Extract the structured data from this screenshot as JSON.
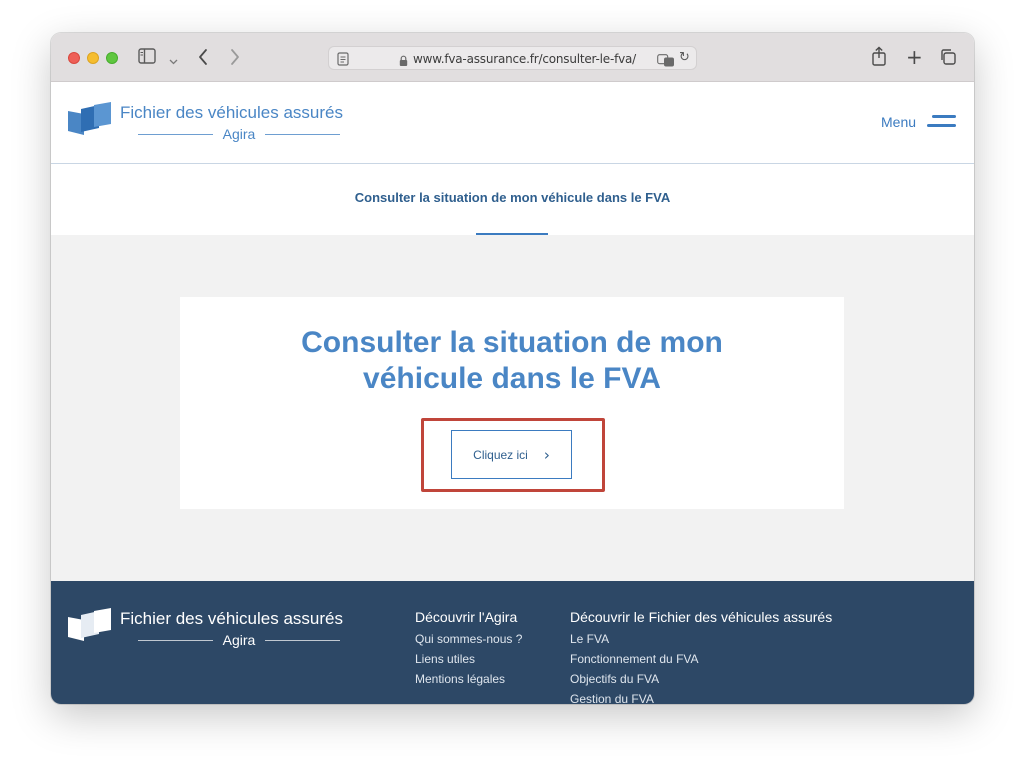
{
  "browser": {
    "url": "www.fva-assurance.fr/consulter-le-fva/"
  },
  "header": {
    "logo_title": "Fichier des véhicules assurés",
    "logo_subtitle": "Agira",
    "menu_label": "Menu"
  },
  "subnav": {
    "title": "Consulter la situation de mon véhicule dans le FVA"
  },
  "main": {
    "heading_line1": "Consulter la situation de mon",
    "heading_line2": "véhicule dans le FVA",
    "cta_label": "Cliquez ici",
    "cta_icon": "chevron-right-icon"
  },
  "footer": {
    "logo_title": "Fichier des véhicules assurés",
    "logo_subtitle": "Agira",
    "col1": {
      "heading": "Découvrir l'Agira",
      "links": [
        "Qui sommes-nous ?",
        "Liens utiles",
        "Mentions légales"
      ]
    },
    "col2": {
      "heading": "Découvrir le Fichier des véhicules assurés",
      "links": [
        "Le FVA",
        "Fonctionnement du FVA",
        "Objectifs du FVA",
        "Gestion du FVA"
      ]
    }
  },
  "colors": {
    "brand_blue": "#4a86c5",
    "footer_bg": "#2d4866",
    "highlight_red": "#c0453a"
  }
}
